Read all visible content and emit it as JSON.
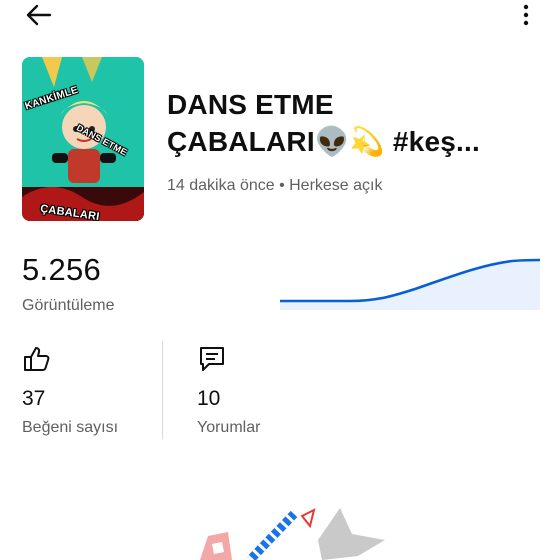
{
  "video": {
    "title_line1": "DANS ETME",
    "title_line2": "ÇABALARI👽💫 #keş...",
    "meta": "14 dakika önce • Herkese açık",
    "thumbnail_text_1": "KANKİMLE",
    "thumbnail_text_2": "DANS ETME",
    "thumbnail_text_3": "ÇABALARI"
  },
  "stats": {
    "views_value": "5.256",
    "views_label": "Görüntüleme",
    "likes_value": "37",
    "likes_label": "Beğeni sayısı",
    "comments_value": "10",
    "comments_label": "Yorumlar"
  },
  "icons": {
    "back": "arrow-left-icon",
    "more": "more-vertical-icon",
    "likes": "thumbs-up-icon",
    "comments": "comment-icon"
  },
  "colors": {
    "accent": "#065fd4",
    "sparkline_fill": "#e8f1fd",
    "thumbnail_bg": "#1fc3a8"
  }
}
